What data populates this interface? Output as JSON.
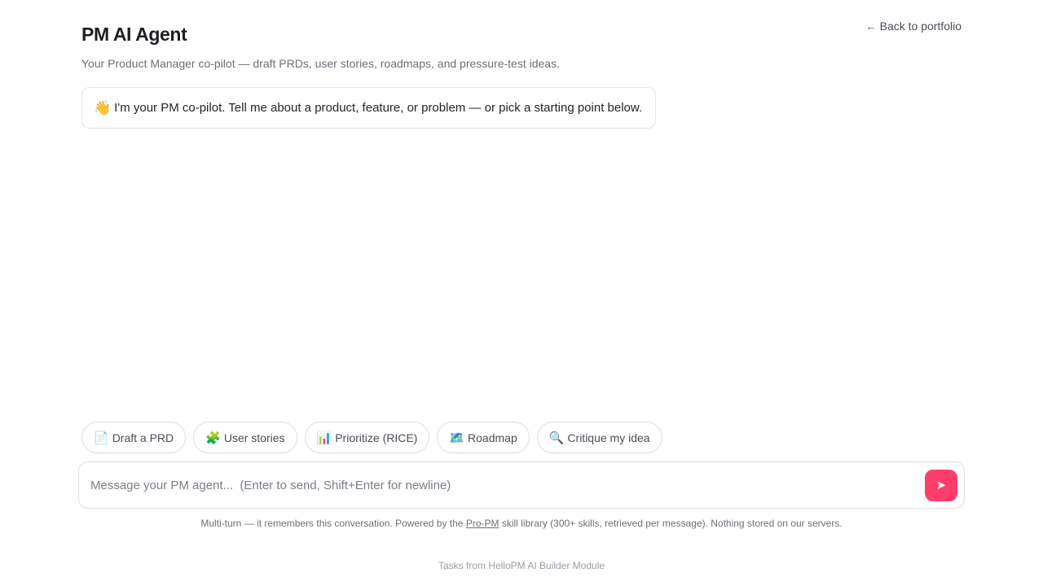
{
  "header": {
    "title": "PM AI Agent",
    "subtitle": "Your Product Manager co-pilot — draft PRDs, user stories, roadmaps, and pressure-test ideas.",
    "back_arrow": "←",
    "back_label": "Back to portfolio"
  },
  "greeting": {
    "emoji": "👋",
    "text": "I'm your PM co-pilot. Tell me about a product, feature, or problem — or pick a starting point below."
  },
  "chips": [
    {
      "icon": "📄",
      "label": "Draft a PRD"
    },
    {
      "icon": "🧩",
      "label": "User stories"
    },
    {
      "icon": "📊",
      "label": "Prioritize (RICE)"
    },
    {
      "icon": "🗺️",
      "label": "Roadmap"
    },
    {
      "icon": "🔍",
      "label": "Critique my idea"
    }
  ],
  "composer": {
    "placeholder": "Message your PM agent...  (Enter to send, Shift+Enter for newline)",
    "value": "",
    "send_icon": "➤"
  },
  "footnote": {
    "before": "Multi-turn — it remembers this conversation. Powered by the ",
    "link": "Pro-PM",
    "after": " skill library (300+ skills, retrieved per message). Nothing stored on our servers."
  },
  "credit": "Tasks from HelloPM AI Builder Module",
  "colors": {
    "accent": "#ff3d6b",
    "border": "#dcdfe3",
    "muted_text": "#6b7078"
  }
}
